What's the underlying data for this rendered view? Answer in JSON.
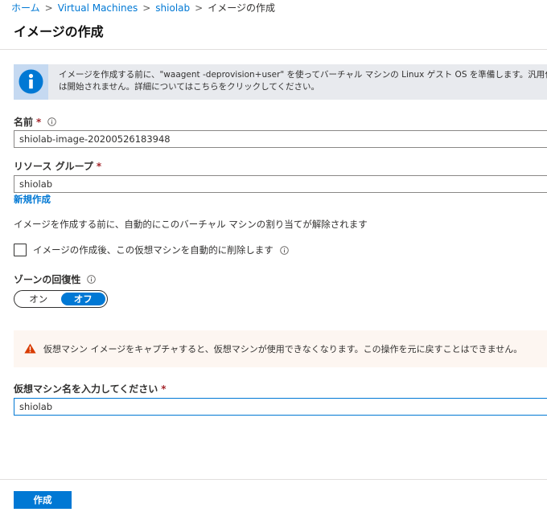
{
  "breadcrumb": {
    "home": "ホーム",
    "vm": "Virtual Machines",
    "vm_name": "shiolab",
    "current": "イメージの作成"
  },
  "page_title": "イメージの作成",
  "info_banner": {
    "icon": "info-icon",
    "line1": "イメージを作成する前に、\"waagent -deprovision+user\" を使ってバーチャル マシンの Linux ゲスト OS を準備します。汎用化さ",
    "line2": "は開始されません。詳細についてはこちらをクリックしてください。"
  },
  "name_field": {
    "label": "名前",
    "required_mark": "*",
    "value": "shiolab-image-20200526183948"
  },
  "resource_group": {
    "label": "リソース グループ",
    "required_mark": "*",
    "value": "shiolab",
    "create_new": "新規作成"
  },
  "dealloc_note": "イメージを作成する前に、自動的にこのバーチャル マシンの割り当てが解除されます",
  "auto_delete_checkbox": {
    "label": "イメージの作成後、この仮想マシンを自動的に削除します",
    "checked": false
  },
  "zone_resiliency": {
    "label": "ゾーンの回復性",
    "on": "オン",
    "off": "オフ",
    "selected": "off"
  },
  "warning_banner": {
    "icon": "warning-icon",
    "text": "仮想マシン イメージをキャプチャすると、仮想マシンが使用できなくなります。この操作を元に戻すことはできません。"
  },
  "vm_name_confirm": {
    "label": "仮想マシン名を入力してください",
    "required_mark": "*",
    "value": "shiolab"
  },
  "footer": {
    "create_button": "作成"
  },
  "colors": {
    "accent": "#0078d4",
    "required": "#a4262c",
    "warning": "#d83b01"
  }
}
